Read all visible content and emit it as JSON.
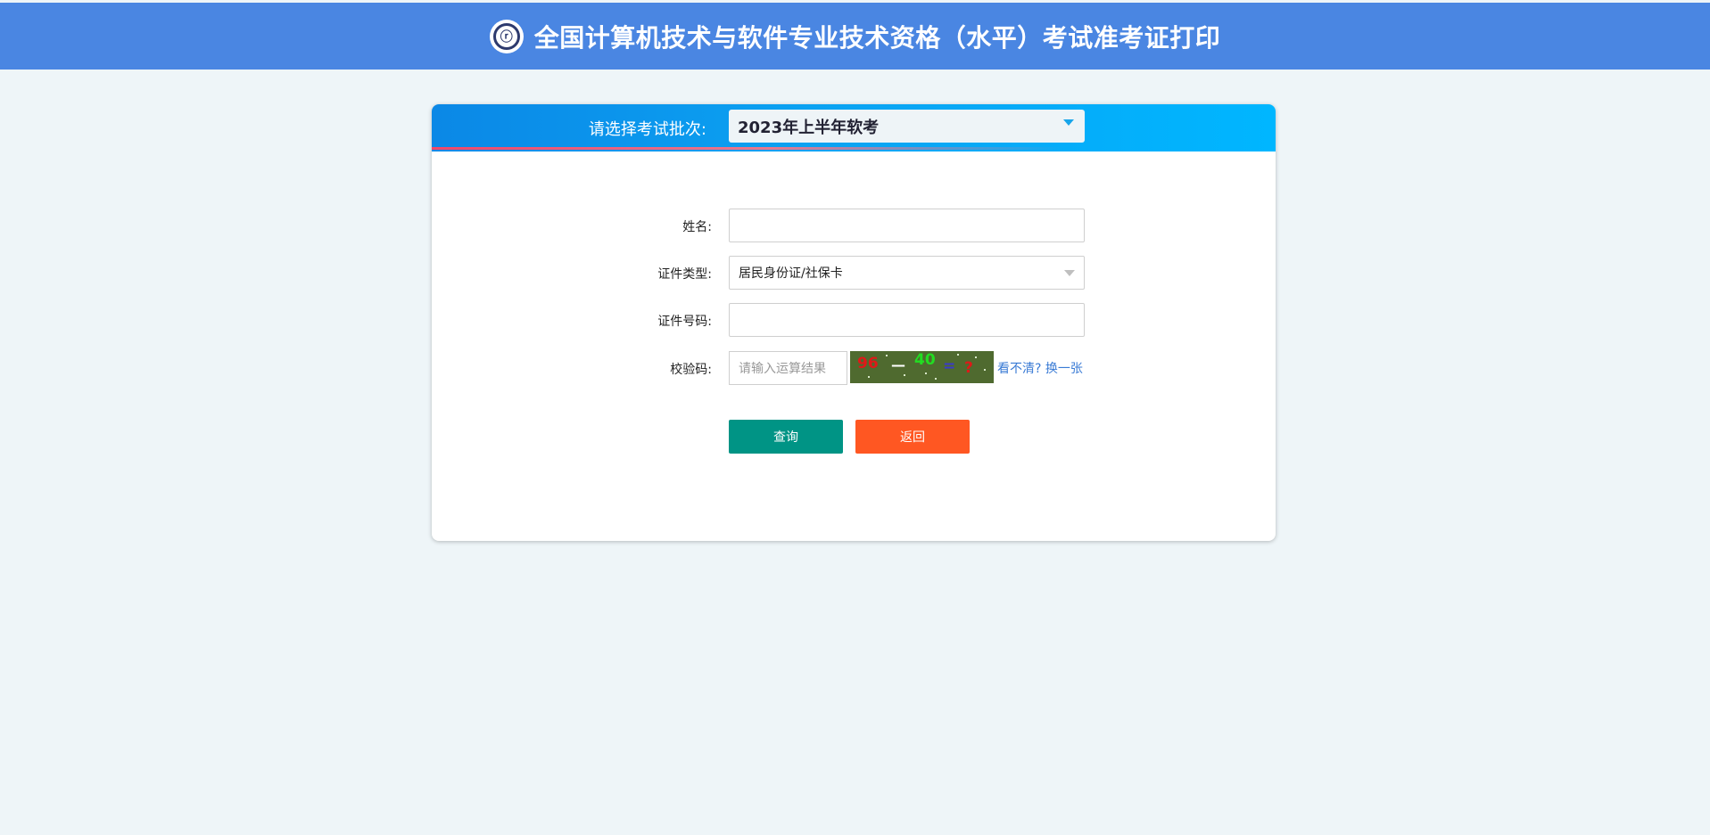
{
  "header": {
    "logo_icon": "exam-emblem-icon",
    "title": "全国计算机技术与软件专业技术资格（水平）考试准考证打印"
  },
  "batch": {
    "label": "请选择考试批次:",
    "selected": "2023年上半年软考"
  },
  "form": {
    "name": {
      "label": "姓名:",
      "value": ""
    },
    "id_type": {
      "label": "证件类型:",
      "selected": "居民身份证/社保卡"
    },
    "id_number": {
      "label": "证件号码:",
      "value": ""
    },
    "captcha": {
      "label": "校验码:",
      "placeholder": "请输入运算结果",
      "image_text": {
        "a": "96",
        "op": "—",
        "b": "40",
        "eq": "=",
        "q": "?"
      },
      "refresh_label": "看不清? 换一张"
    }
  },
  "buttons": {
    "query": "查询",
    "back": "返回"
  },
  "colors": {
    "topbar": "#4a86e2",
    "query_button": "#009485",
    "back_button": "#ff5722",
    "link": "#3a7bd5"
  }
}
